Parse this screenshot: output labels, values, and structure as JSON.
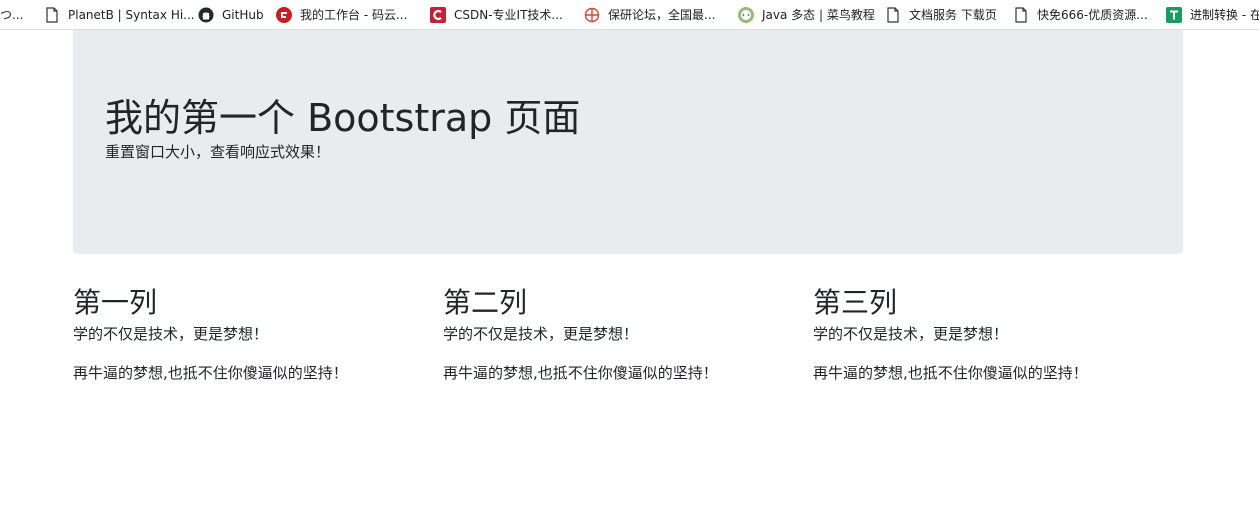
{
  "bookmarks": [
    {
      "label": "つ...",
      "icon": "none"
    },
    {
      "label": "PlanetB | Syntax Hi...",
      "icon": "page-icon"
    },
    {
      "label": "GitHub",
      "icon": "github-icon"
    },
    {
      "label": "我的工作台 - 码云...",
      "icon": "gitee-icon"
    },
    {
      "label": "CSDN-专业IT技术...",
      "icon": "csdn-icon"
    },
    {
      "label": "保研论坛，全国最...",
      "icon": "baoyan-icon"
    },
    {
      "label": "Java 多态 | 菜鸟教程",
      "icon": "runoob-icon"
    },
    {
      "label": "文档服务 下载页",
      "icon": "page-icon"
    },
    {
      "label": "快免666-优质资源...",
      "icon": "page-icon"
    },
    {
      "label": "进制转换 - 在",
      "icon": "t-icon"
    }
  ],
  "jumbotron": {
    "title": "我的第一个 Bootstrap 页面",
    "subtitle": "重置窗口大小，查看响应式效果！"
  },
  "columns": [
    {
      "heading": "第一列",
      "line1": "学的不仅是技术，更是梦想！",
      "line2": "再牛逼的梦想,也抵不住你傻逼似的坚持！"
    },
    {
      "heading": "第二列",
      "line1": "学的不仅是技术，更是梦想！",
      "line2": "再牛逼的梦想,也抵不住你傻逼似的坚持！"
    },
    {
      "heading": "第三列",
      "line1": "学的不仅是技术，更是梦想！",
      "line2": "再牛逼的梦想,也抵不住你傻逼似的坚持！"
    }
  ],
  "colors": {
    "jumbotron_bg": "#e9ecef",
    "text": "#212529",
    "gitee_red": "#c71d23",
    "csdn_red": "#c32136",
    "runoob_green": "#96b97d",
    "t_green": "#1a9b5f"
  }
}
